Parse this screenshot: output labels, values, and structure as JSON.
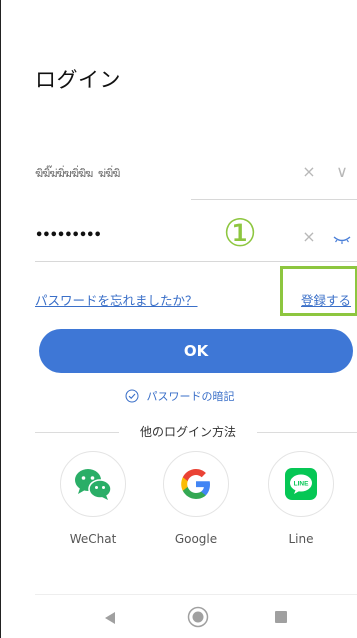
{
  "page": {
    "title": "ログイン"
  },
  "account": {
    "value": "ฆิฆิ๊ฆ่ฆิ่ฆฆิ่ฆิฆ ฆ่ฆิ่ฆิ",
    "clear_icon": "×",
    "dropdown_icon": "∨"
  },
  "password": {
    "value": "•••••••••",
    "clear_icon": "×"
  },
  "annotation": {
    "marker": "①",
    "color": "#8dc63f"
  },
  "links": {
    "forgot": "パスワードを忘れましたか？",
    "register": "登録する"
  },
  "ok_button": {
    "label": "OK",
    "color": "#3e77d6"
  },
  "remember": {
    "label": "パスワードの暗記"
  },
  "other_login": {
    "title": "他のログイン方法",
    "methods": [
      {
        "label": "WeChat",
        "icon": "wechat-icon"
      },
      {
        "label": "Google",
        "icon": "google-icon"
      },
      {
        "label": "Line",
        "icon": "line-icon"
      }
    ]
  },
  "nav": {
    "back": "back-icon",
    "home": "home-icon",
    "recent": "recent-apps-icon"
  }
}
